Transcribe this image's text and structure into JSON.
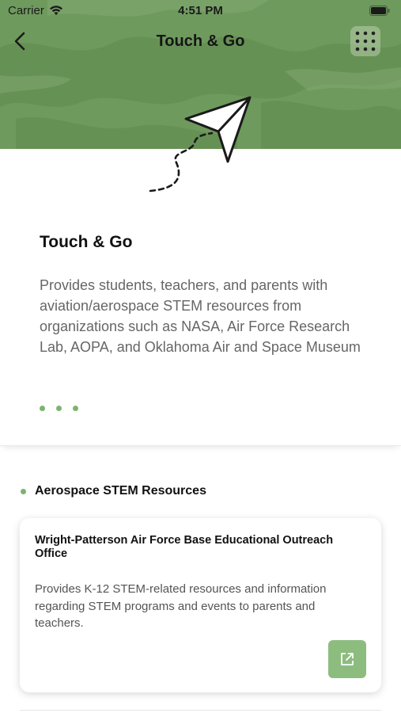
{
  "status_bar": {
    "carrier": "Carrier",
    "time": "4:51 PM",
    "wifi_icon": "wifi-icon",
    "battery_icon": "battery-icon"
  },
  "nav": {
    "title": "Touch & Go",
    "back_icon": "chevron-left-icon",
    "menu_icon": "grid-dots-icon"
  },
  "colors": {
    "header_green": "#6f9a5e",
    "accent_green": "#7db36f",
    "button_green": "#8cbd7f"
  },
  "intro": {
    "title": "Touch & Go",
    "description": "Provides students, teachers, and parents with aviation/aerospace STEM resources from organizations such as NASA, Air Force Research Lab, AOPA, and Oklahoma Air and Space Museum",
    "more_icon": "ellipsis-dots-icon"
  },
  "section": {
    "title": "Aerospace STEM Resources",
    "resources": [
      {
        "title": "Wright-Patterson Air Force Base Educational Outreach Office",
        "description": "Provides K-12 STEM-related resources and information regarding STEM programs and events to parents and teachers.",
        "action_icon": "external-link-icon"
      }
    ]
  }
}
